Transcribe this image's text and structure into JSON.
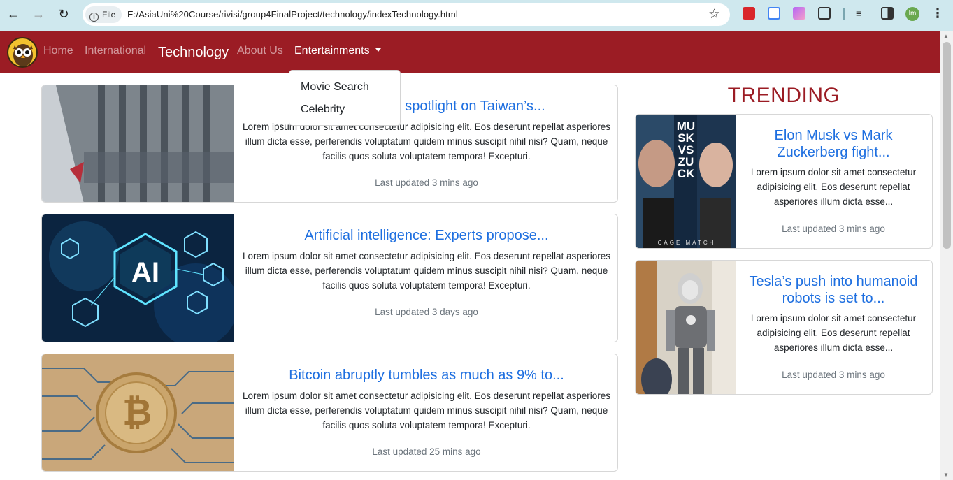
{
  "browser": {
    "security_chip": "File",
    "url": "E:/AsiaUni%20Course/rivisi/group4FinalProject/technology/indexTechnology.html",
    "profile_initials": "lm"
  },
  "navbar": {
    "links": [
      "Home",
      "International",
      "Technology",
      "About Us",
      "Entertainments"
    ],
    "dropdown": [
      "Movie Search",
      "Celebrity"
    ]
  },
  "articles": [
    {
      "title": "Tensions throw spotlight on Taiwan’s...",
      "body": "Lorem ipsum dolor sit amet consectetur adipisicing elit. Eos deserunt repellat asperiores illum dicta esse, perferendis voluptatum quidem minus suscipit nihil nisi? Quam, neque facilis quos soluta voluptatem tempora! Excepturi.",
      "updated": "Last updated 3 mins ago"
    },
    {
      "title": "Artificial intelligence: Experts propose...",
      "body": "Lorem ipsum dolor sit amet consectetur adipisicing elit. Eos deserunt repellat asperiores illum dicta esse, perferendis voluptatum quidem minus suscipit nihil nisi? Quam, neque facilis quos soluta voluptatem tempora! Excepturi.",
      "updated": "Last updated 3 days ago",
      "image_text": "AI"
    },
    {
      "title": "Bitcoin abruptly tumbles as much as 9% to...",
      "body": "Lorem ipsum dolor sit amet consectetur adipisicing elit. Eos deserunt repellat asperiores illum dicta esse, perferendis voluptatum quidem minus suscipit nihil nisi? Quam, neque facilis quos soluta voluptatem tempora! Excepturi.",
      "updated": "Last updated 25 mins ago"
    }
  ],
  "trending": {
    "heading": "TRENDING",
    "items": [
      {
        "title": "Elon Musk vs Mark Zuckerberg fight...",
        "body": "Lorem ipsum dolor sit amet consectetur adipisicing elit. Eos deserunt repellat asperiores illum dicta esse...",
        "updated": "Last updated 3 mins ago",
        "image_text": "MUSK VS ZUCK",
        "image_caption": "CAGE MATCH"
      },
      {
        "title": "Tesla’s push into humanoid robots is set to...",
        "body": "Lorem ipsum dolor sit amet consectetur adipisicing elit. Eos deserunt repellat asperiores illum dicta esse...",
        "updated": "Last updated 3 mins ago"
      }
    ]
  },
  "colors": {
    "brand": "#9b1c24",
    "link": "#1e6fe0",
    "muted": "#6c757d"
  }
}
